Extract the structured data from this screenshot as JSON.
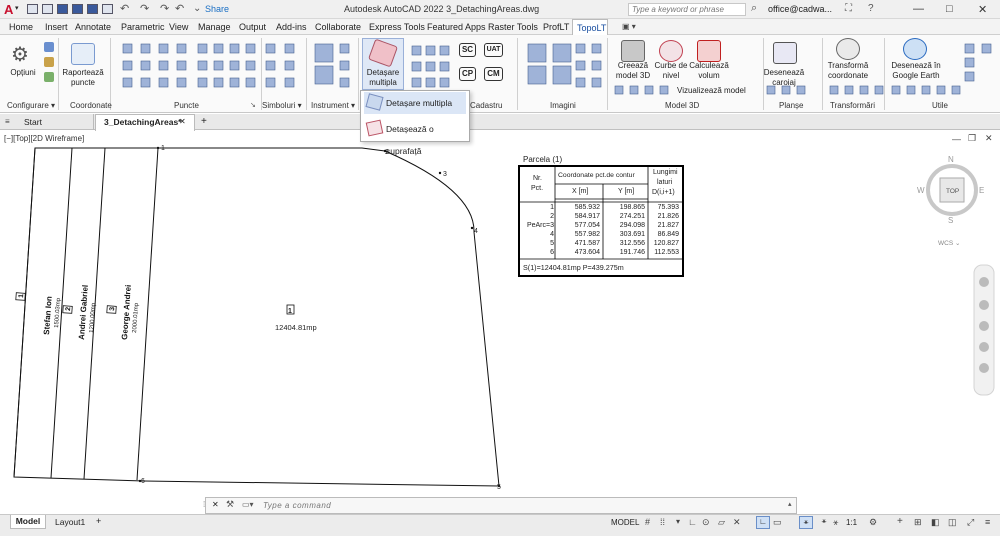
{
  "app": {
    "logo": "A",
    "share_label": "Share",
    "title": "Autodesk AutoCAD 2022   3_DetachingAreas.dwg",
    "search_placeholder": "Type a keyword or phrase",
    "user": "office@cadwa...",
    "minimize": "—",
    "maximize": "□",
    "close": "✕"
  },
  "menu_tabs": [
    "Home",
    "Insert",
    "Annotate",
    "Parametric",
    "View",
    "Manage",
    "Output",
    "Add-ins",
    "Collaborate",
    "Express Tools",
    "Featured Apps",
    "Raster Tools",
    "ProfLT",
    "TopoLT"
  ],
  "ribbon": {
    "optiuni": "Opțiuni",
    "raporteaza": "Raportează",
    "raporteaza2": "puncte",
    "detasare": "Detașare",
    "detasare2": "multipla",
    "creeaza_model": "Creează",
    "creeaza_model2": "model 3D",
    "curbe_nivel": "Curbe de",
    "curbe_nivel2": "nivel",
    "calculeaza_volum": "Calculează",
    "calculeaza_volum2": "volum",
    "vizualizeaza": "Vizualizează model",
    "deseneaza_caroiaj": "Desenează",
    "deseneaza_caroiaj2": "caroiaj",
    "transforma": "Transformă",
    "transforma2": "coordonate",
    "google_earth": "Desenează în",
    "google_earth2": "Google Earth",
    "sc": "SC",
    "uat": "UAT",
    "cp": "CP",
    "cm": "CM",
    "panels": [
      "Configurare ▾",
      "Coordonate",
      "Puncte",
      "Simboluri ▾",
      "Instrument ▾",
      "Cadastru",
      "Imagini",
      "Model 3D",
      "Planșe",
      "Transformări",
      "Utile"
    ]
  },
  "dropdown": {
    "item1": "Detașare  multipla",
    "item2": "Detașează o  suprafață"
  },
  "doc_tabs": {
    "start": "Start",
    "active": "3_DetachingAreas*",
    "close": "✕",
    "add": "+"
  },
  "viewport": {
    "label": "[−][Top][2D Wireframe]",
    "vertices": [
      "1",
      "2",
      "3",
      "4",
      "5",
      "6"
    ],
    "main_area": "12404.81mp",
    "main_parcel_no": "1",
    "strips": [
      {
        "no": "1",
        "name": "Stefan Ion",
        "area": "1500.03mp"
      },
      {
        "no": "2",
        "name": "Andrei Gabriel",
        "area": "1200.00mp"
      },
      {
        "no": "3",
        "name": "George Andrei",
        "area": "2000.01mp"
      }
    ],
    "viewcube": {
      "n": "N",
      "s": "S",
      "e": "E",
      "w": "W",
      "top": "TOP",
      "wcs": "WCS ⌄"
    }
  },
  "parcel_table": {
    "title": "Parcela (1)",
    "h_nr": "Nr.",
    "h_pct": "Pct.",
    "h_coord": "Coordonate pct.de contur",
    "h_x": "X [m]",
    "h_y": "Y [m]",
    "h_len1": "Lungimi",
    "h_len2": "laturi",
    "h_len3": "D(i,i+1)",
    "rows": [
      {
        "pt": "1",
        "x": "585.932",
        "y": "198.865",
        "d": "75.393"
      },
      {
        "pt": "2",
        "x": "584.917",
        "y": "274.251",
        "d": "21.826"
      },
      {
        "pt": "PeArc=3",
        "x": "577.054",
        "y": "294.098",
        "d": "21.827"
      },
      {
        "pt": "4",
        "x": "557.982",
        "y": "303.691",
        "d": "86.849"
      },
      {
        "pt": "5",
        "x": "471.587",
        "y": "312.556",
        "d": "120.827"
      },
      {
        "pt": "6",
        "x": "473.604",
        "y": "191.746",
        "d": "112.553"
      }
    ],
    "footer": "S(1)=12404.81mp  P=439.275m"
  },
  "command": {
    "placeholder": "Type a command",
    "close": "✕"
  },
  "status": {
    "model_tab": "Model",
    "layout_tab": "Layout1",
    "add": "+",
    "model": "MODEL",
    "scale": "1:1"
  }
}
